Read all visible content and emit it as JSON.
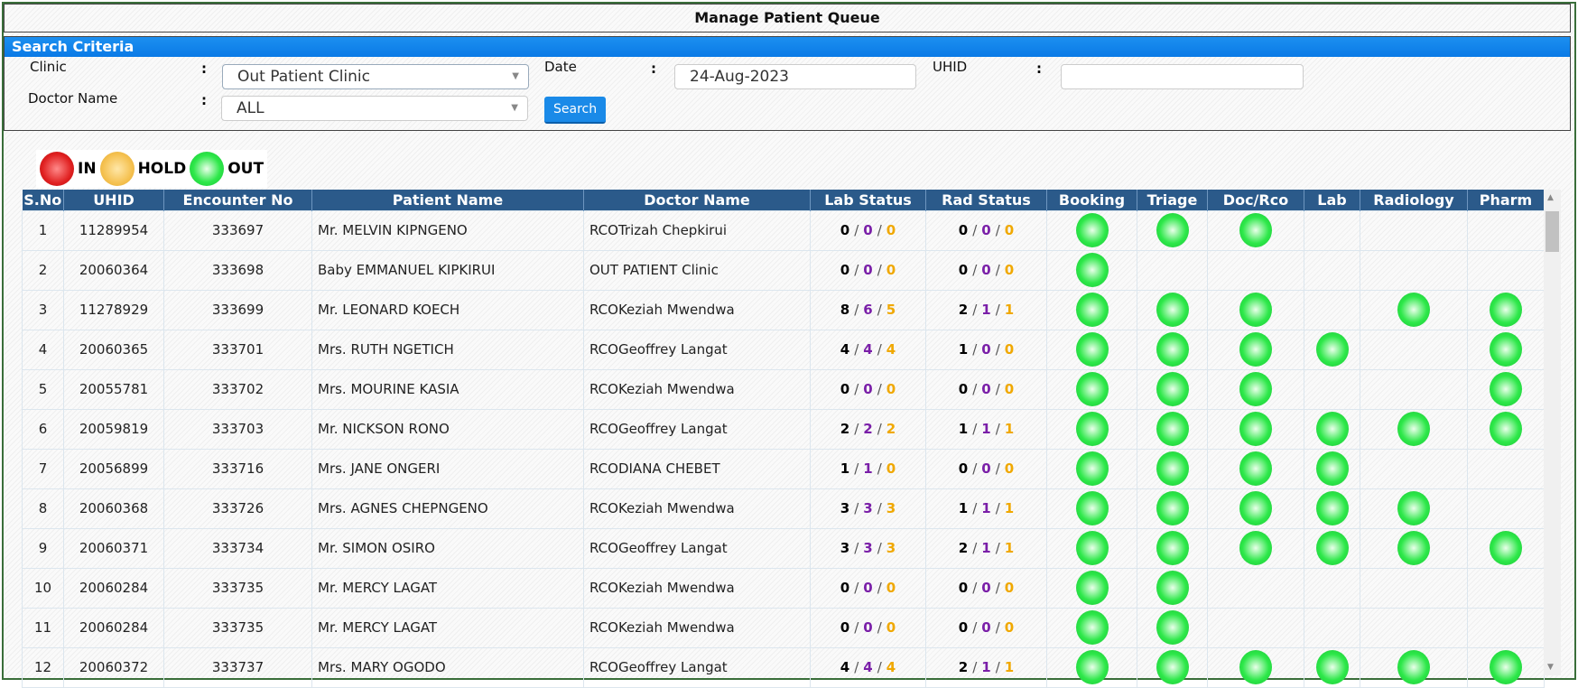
{
  "title": "Manage Patient Queue",
  "search": {
    "heading": "Search Criteria",
    "clinic_label": "Clinic",
    "clinic_value": "Out Patient Clinic",
    "date_label": "Date",
    "date_value": "24-Aug-2023",
    "uhid_label": "UHID",
    "uhid_value": "",
    "doctor_label": "Doctor Name",
    "doctor_value": "ALL",
    "search_button": "Search",
    "colon": ":"
  },
  "legend": {
    "in": "IN",
    "hold": "HOLD",
    "out": "OUT"
  },
  "columns": [
    "S.No",
    "UHID",
    "Encounter No",
    "Patient Name",
    "Doctor Name",
    "Lab Status",
    "Rad Status",
    "Booking",
    "Triage",
    "Doc/Rco",
    "Lab",
    "Radiology",
    "Pharm"
  ],
  "colors": {
    "out": "#2ee84a",
    "header": "#2b5a8a",
    "accent": "#1a8ae8"
  },
  "rows": [
    {
      "sno": "1",
      "uhid": "11289954",
      "enc": "333697",
      "patient": "Mr. MELVIN KIPNGENO",
      "doctor": "RCOTrizah Chepkirui",
      "lab": [
        "0",
        "0",
        "0"
      ],
      "rad": [
        "0",
        "0",
        "0"
      ],
      "stages": [
        1,
        1,
        1,
        0,
        0,
        0
      ]
    },
    {
      "sno": "2",
      "uhid": "20060364",
      "enc": "333698",
      "patient": "Baby EMMANUEL KIPKIRUI",
      "doctor": "OUT PATIENT Clinic",
      "lab": [
        "0",
        "0",
        "0"
      ],
      "rad": [
        "0",
        "0",
        "0"
      ],
      "stages": [
        1,
        0,
        0,
        0,
        0,
        0
      ]
    },
    {
      "sno": "3",
      "uhid": "11278929",
      "enc": "333699",
      "patient": "Mr. LEONARD KOECH",
      "doctor": "RCOKeziah Mwendwa",
      "lab": [
        "8",
        "6",
        "5"
      ],
      "rad": [
        "2",
        "1",
        "1"
      ],
      "stages": [
        1,
        1,
        1,
        0,
        1,
        1
      ]
    },
    {
      "sno": "4",
      "uhid": "20060365",
      "enc": "333701",
      "patient": "Mrs. RUTH NGETICH",
      "doctor": "RCOGeoffrey Langat",
      "lab": [
        "4",
        "4",
        "4"
      ],
      "rad": [
        "1",
        "0",
        "0"
      ],
      "stages": [
        1,
        1,
        1,
        1,
        0,
        1
      ]
    },
    {
      "sno": "5",
      "uhid": "20055781",
      "enc": "333702",
      "patient": "Mrs. MOURINE KASIA",
      "doctor": "RCOKeziah Mwendwa",
      "lab": [
        "0",
        "0",
        "0"
      ],
      "rad": [
        "0",
        "0",
        "0"
      ],
      "stages": [
        1,
        1,
        1,
        0,
        0,
        1
      ]
    },
    {
      "sno": "6",
      "uhid": "20059819",
      "enc": "333703",
      "patient": "Mr. NICKSON RONO",
      "doctor": "RCOGeoffrey Langat",
      "lab": [
        "2",
        "2",
        "2"
      ],
      "rad": [
        "1",
        "1",
        "1"
      ],
      "stages": [
        1,
        1,
        1,
        1,
        1,
        1
      ]
    },
    {
      "sno": "7",
      "uhid": "20056899",
      "enc": "333716",
      "patient": "Mrs. JANE ONGERI",
      "doctor": "RCODIANA CHEBET",
      "lab": [
        "1",
        "1",
        "0"
      ],
      "rad": [
        "0",
        "0",
        "0"
      ],
      "stages": [
        1,
        1,
        1,
        1,
        0,
        0
      ]
    },
    {
      "sno": "8",
      "uhid": "20060368",
      "enc": "333726",
      "patient": "Mrs. AGNES CHEPNGENO",
      "doctor": "RCOKeziah Mwendwa",
      "lab": [
        "3",
        "3",
        "3"
      ],
      "rad": [
        "1",
        "1",
        "1"
      ],
      "stages": [
        1,
        1,
        1,
        1,
        1,
        0
      ]
    },
    {
      "sno": "9",
      "uhid": "20060371",
      "enc": "333734",
      "patient": "Mr. SIMON OSIRO",
      "doctor": "RCOGeoffrey Langat",
      "lab": [
        "3",
        "3",
        "3"
      ],
      "rad": [
        "2",
        "1",
        "1"
      ],
      "stages": [
        1,
        1,
        1,
        1,
        1,
        1
      ]
    },
    {
      "sno": "10",
      "uhid": "20060284",
      "enc": "333735",
      "patient": "Mr. MERCY LAGAT",
      "doctor": "RCOKeziah Mwendwa",
      "lab": [
        "0",
        "0",
        "0"
      ],
      "rad": [
        "0",
        "0",
        "0"
      ],
      "stages": [
        1,
        1,
        0,
        0,
        0,
        0
      ]
    },
    {
      "sno": "11",
      "uhid": "20060284",
      "enc": "333735",
      "patient": "Mr. MERCY LAGAT",
      "doctor": "RCOKeziah Mwendwa",
      "lab": [
        "0",
        "0",
        "0"
      ],
      "rad": [
        "0",
        "0",
        "0"
      ],
      "stages": [
        1,
        1,
        0,
        0,
        0,
        0
      ]
    },
    {
      "sno": "12",
      "uhid": "20060372",
      "enc": "333737",
      "patient": "Mrs. MARY OGODO",
      "doctor": "RCOGeoffrey Langat",
      "lab": [
        "4",
        "4",
        "4"
      ],
      "rad": [
        "2",
        "1",
        "1"
      ],
      "stages": [
        1,
        1,
        1,
        1,
        1,
        1
      ]
    }
  ]
}
